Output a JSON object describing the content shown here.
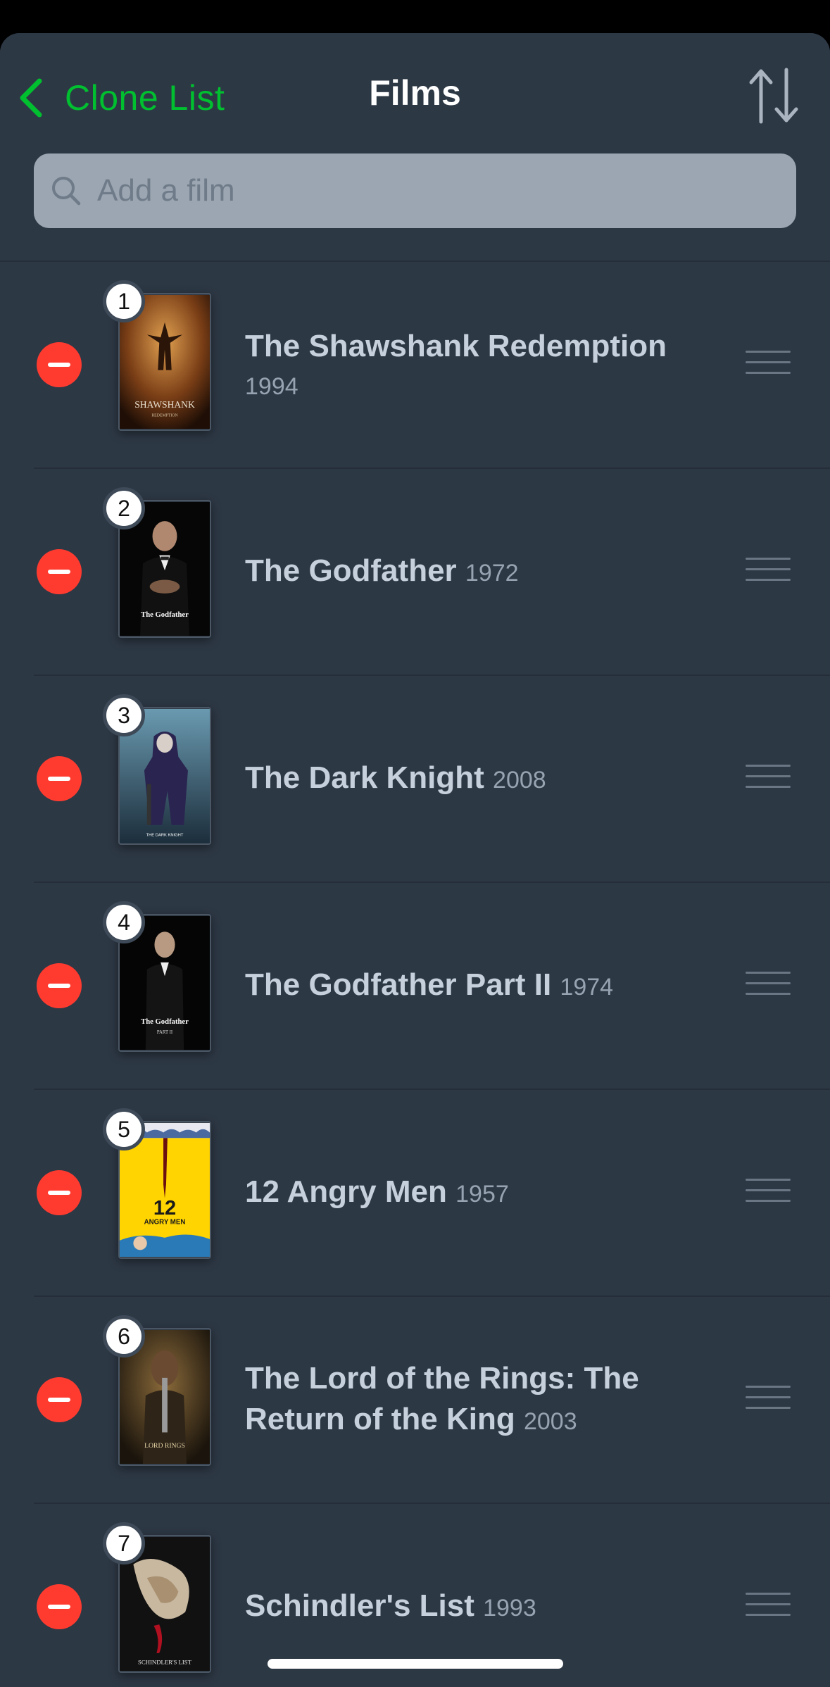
{
  "header": {
    "back_label": "Clone List",
    "title": "Films",
    "accent_color": "#00c030"
  },
  "search": {
    "placeholder": "Add a film"
  },
  "films": [
    {
      "rank": "1",
      "title": "The Shawshank Redemption",
      "year": "1994",
      "year_on_new_line": true
    },
    {
      "rank": "2",
      "title": "The Godfather",
      "year": "1972"
    },
    {
      "rank": "3",
      "title": "The Dark Knight",
      "year": "2008"
    },
    {
      "rank": "4",
      "title": "The Godfather Part II",
      "year": "1974"
    },
    {
      "rank": "5",
      "title": "12 Angry Men",
      "year": "1957"
    },
    {
      "rank": "6",
      "title": "The Lord of the Rings: The Return of the King",
      "year": "2003"
    },
    {
      "rank": "7",
      "title": "Schindler's List",
      "year": "1993"
    }
  ],
  "posters": {
    "1": {
      "caption": "SHAWSHANK",
      "sub": "REDEMPTION"
    },
    "2": {
      "caption": "The Godfather"
    },
    "3": {
      "caption": "THE DARK KNIGHT"
    },
    "4": {
      "caption": "The Godfather",
      "sub": "PART II"
    },
    "5": {
      "caption": "12",
      "sub": "ANGRY MEN"
    },
    "6": {
      "caption": "LORD RINGS"
    },
    "7": {
      "caption": "SCHINDLER'S LIST"
    }
  },
  "icons": {
    "back": "chevron-left-icon",
    "sort": "sort-arrows-icon",
    "search": "search-icon",
    "remove": "remove-minus-icon",
    "drag": "drag-handle-icon"
  }
}
